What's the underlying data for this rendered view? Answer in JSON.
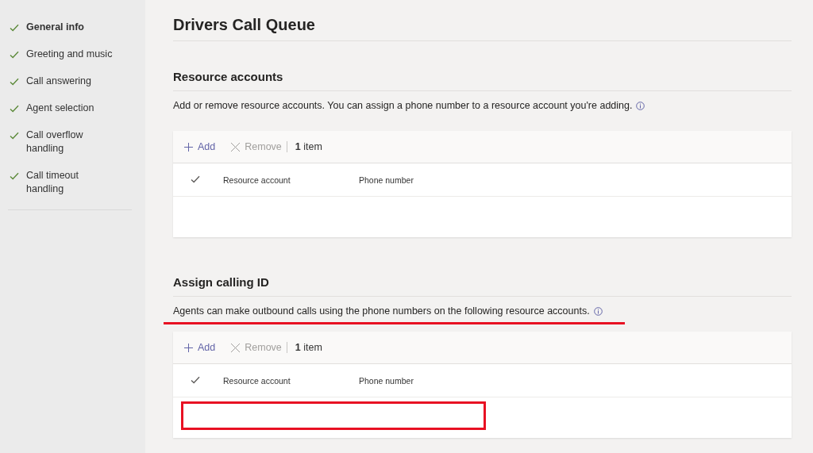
{
  "sidebar": {
    "items": [
      {
        "label": "General info",
        "selected": true,
        "done": true
      },
      {
        "label": "Greeting and music",
        "selected": false,
        "done": true
      },
      {
        "label": "Call answering",
        "selected": false,
        "done": true
      },
      {
        "label": "Agent selection",
        "selected": false,
        "done": true
      },
      {
        "label": "Call overflow handling",
        "selected": false,
        "done": true
      },
      {
        "label": "Call timeout handling",
        "selected": false,
        "done": true
      }
    ]
  },
  "page": {
    "title": "Drivers Call Queue"
  },
  "sections": [
    {
      "heading": "Resource accounts",
      "description": "Add or remove resource accounts. You can assign a phone number to a resource account you're adding.",
      "description_underlined": false,
      "table": {
        "add": "Add",
        "remove": "Remove",
        "remove_disabled": true,
        "count": "1",
        "count_label": "item",
        "columns": [
          "Resource account",
          "Phone number"
        ],
        "row_highlighted": false
      }
    },
    {
      "heading": "Assign calling ID",
      "description": "Agents can make outbound calls using the phone numbers on the following resource accounts.",
      "description_underlined": true,
      "table": {
        "add": "Add",
        "remove": "Remove",
        "remove_disabled": true,
        "count": "1",
        "count_label": "item",
        "columns": [
          "Resource account",
          "Phone number"
        ],
        "row_highlighted": true
      }
    }
  ]
}
